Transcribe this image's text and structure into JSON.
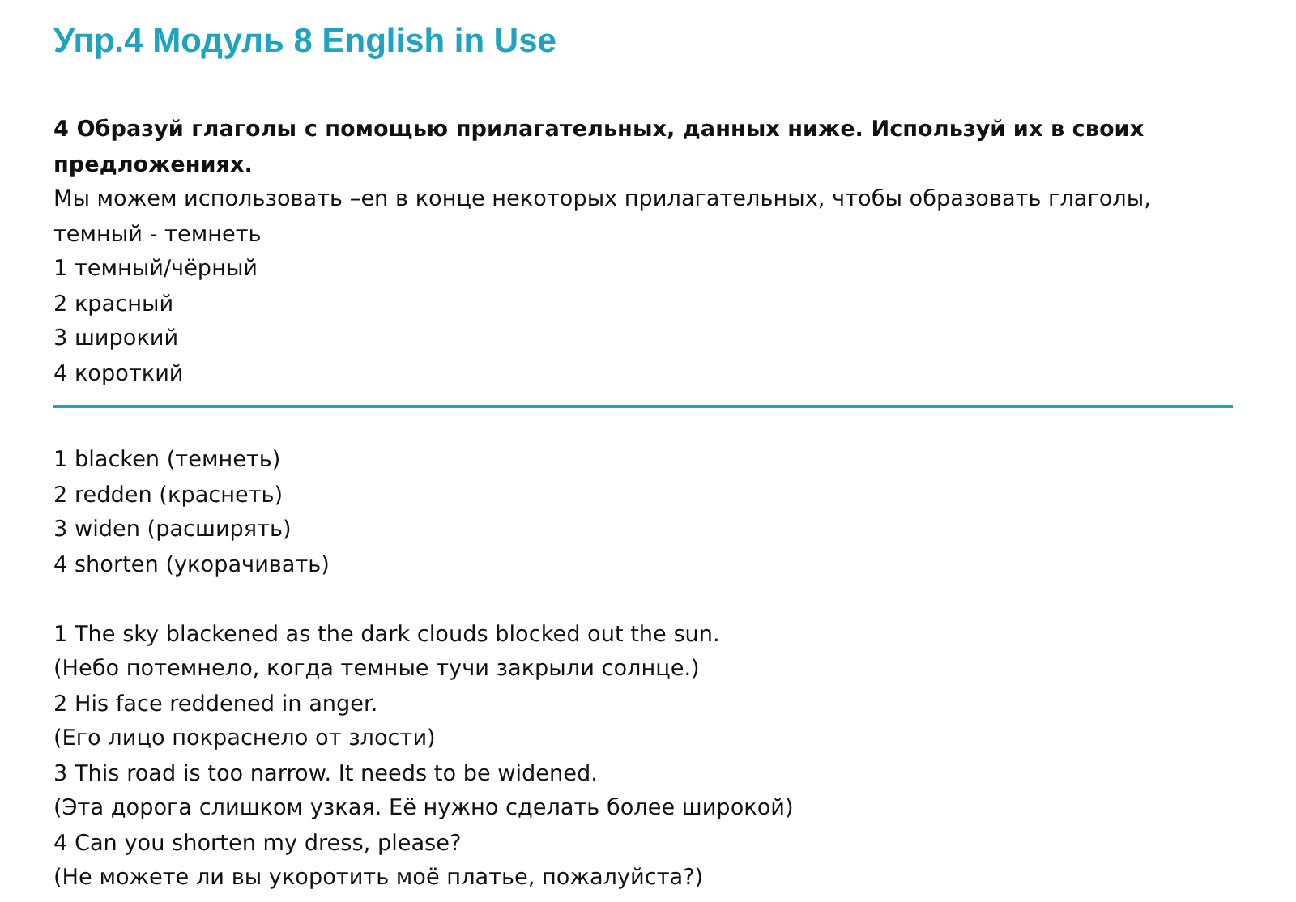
{
  "title": "Упр.4 Модуль 8 English in Use",
  "task": {
    "heading": "4 Образуй глаголы с помощью прилагательных, данных ниже. Используй их в своих предложениях.",
    "intro": "Мы можем использовать –en в конце некоторых прилагательных, чтобы образовать глаголы, темный - темнеть",
    "items": [
      "1 темный/чёрный",
      "2 красный",
      "3 широкий",
      "4 короткий"
    ]
  },
  "answers": {
    "words": [
      "1 blacken (темнеть)",
      "2 redden (краснеть)",
      "3 widen (расширять)",
      "4 shorten (укорачивать)"
    ],
    "sentences": [
      "1 The sky blackened as the dark clouds blocked out the sun.",
      "(Небо потемнело, когда темные тучи закрыли солнце.)",
      "2 His face reddened in anger.",
      "(Его лицо покраснело от злости)",
      "3 This road is too narrow. It needs to be widened.",
      "(Эта дорога слишком узкая. Её нужно сделать более широкой)",
      "4 Can you shorten my dress, please?",
      "(Не можете ли вы укоротить моё платье, пожалуйста?)"
    ]
  }
}
